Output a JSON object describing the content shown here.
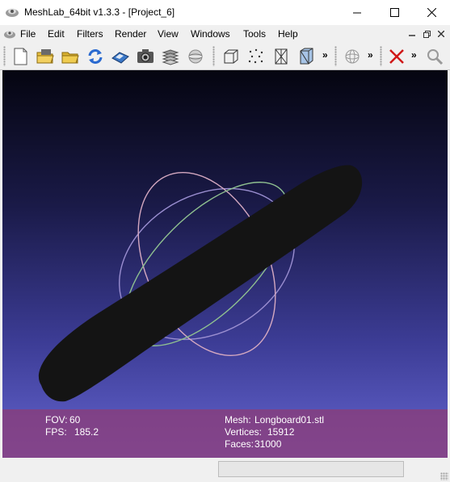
{
  "window": {
    "title": "MeshLab_64bit v1.3.3 - [Project_6]"
  },
  "menu": {
    "items": [
      {
        "label": "File",
        "key": "file"
      },
      {
        "label": "Edit",
        "key": "edit"
      },
      {
        "label": "Filters",
        "key": "filters"
      },
      {
        "label": "Render",
        "key": "render"
      },
      {
        "label": "View",
        "key": "view"
      },
      {
        "label": "Windows",
        "key": "windows"
      },
      {
        "label": "Tools",
        "key": "tools"
      },
      {
        "label": "Help",
        "key": "help"
      }
    ]
  },
  "toolbar": {
    "more_label": "»",
    "icons": [
      "new-project-icon",
      "open-project-icon",
      "open-mesh-icon",
      "reload-icon",
      "save-icon",
      "snapshot-icon",
      "layers-icon",
      "sphere-view-icon",
      "bounding-box-icon",
      "points-icon",
      "wireframe-icon",
      "hidden-lines-icon",
      "trackball-icon",
      "delete-selection-icon",
      "zoom-icon"
    ]
  },
  "viewport": {
    "fov_label": "FOV:",
    "fov_value": "60",
    "fps_label": "FPS:",
    "fps_value": "185.2",
    "mesh_label": "Mesh:",
    "mesh_value": "Longboard01.stl",
    "vertices_label": "Vertices:",
    "vertices_value": "15912",
    "faces_label": "Faces:",
    "faces_value": "31000"
  },
  "colors": {
    "info_panel": "#8c3c78",
    "mesh": "#141414",
    "background_top": "#050510",
    "background_bottom": "#6464cf"
  }
}
